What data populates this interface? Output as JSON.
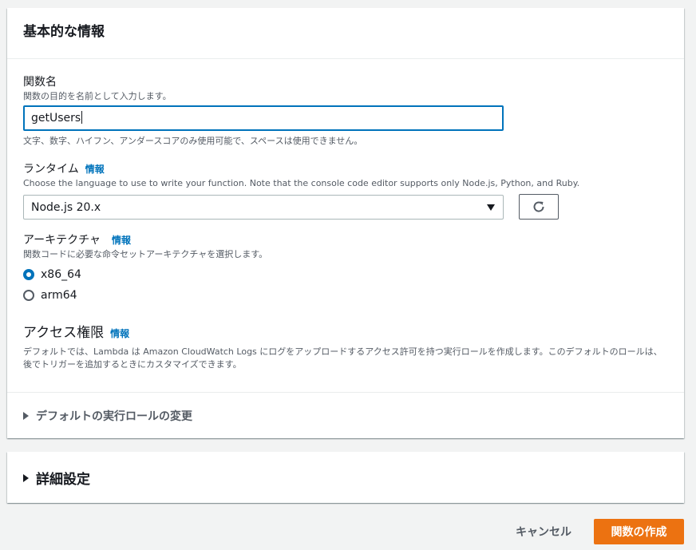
{
  "basic": {
    "title": "基本的な情報",
    "function_name": {
      "label": "関数名",
      "description": "関数の目的を名前として入力します。",
      "value": "getUsers",
      "constraint": "文字、数字、ハイフン、アンダースコアのみ使用可能で、スペースは使用できません。"
    },
    "runtime": {
      "label": "ランタイム",
      "info": "情報",
      "description": "Choose the language to use to write your function. Note that the console code editor supports only Node.js, Python, and Ruby.",
      "selected": "Node.js 20.x"
    },
    "architecture": {
      "label": "アーキテクチャ",
      "info": "情報",
      "description": "関数コードに必要な命令セットアーキテクチャを選択します。",
      "options": [
        {
          "label": "x86_64",
          "checked": true
        },
        {
          "label": "arm64",
          "checked": false
        }
      ]
    },
    "permissions": {
      "label": "アクセス権限",
      "info": "情報",
      "description": "デフォルトでは、Lambda は Amazon CloudWatch Logs にログをアップロードするアクセス許可を持つ実行ロールを作成します。このデフォルトのロールは、後でトリガーを追加するときにカスタマイズできます。"
    },
    "role_expander": "デフォルトの実行ロールの変更"
  },
  "advanced": {
    "title": "詳細設定"
  },
  "footer": {
    "cancel_label": "キャンセル",
    "create_label": "関数の作成"
  },
  "colors": {
    "accent": "#0073bb",
    "primary_button": "#ec7211",
    "background": "#f2f3f3"
  }
}
